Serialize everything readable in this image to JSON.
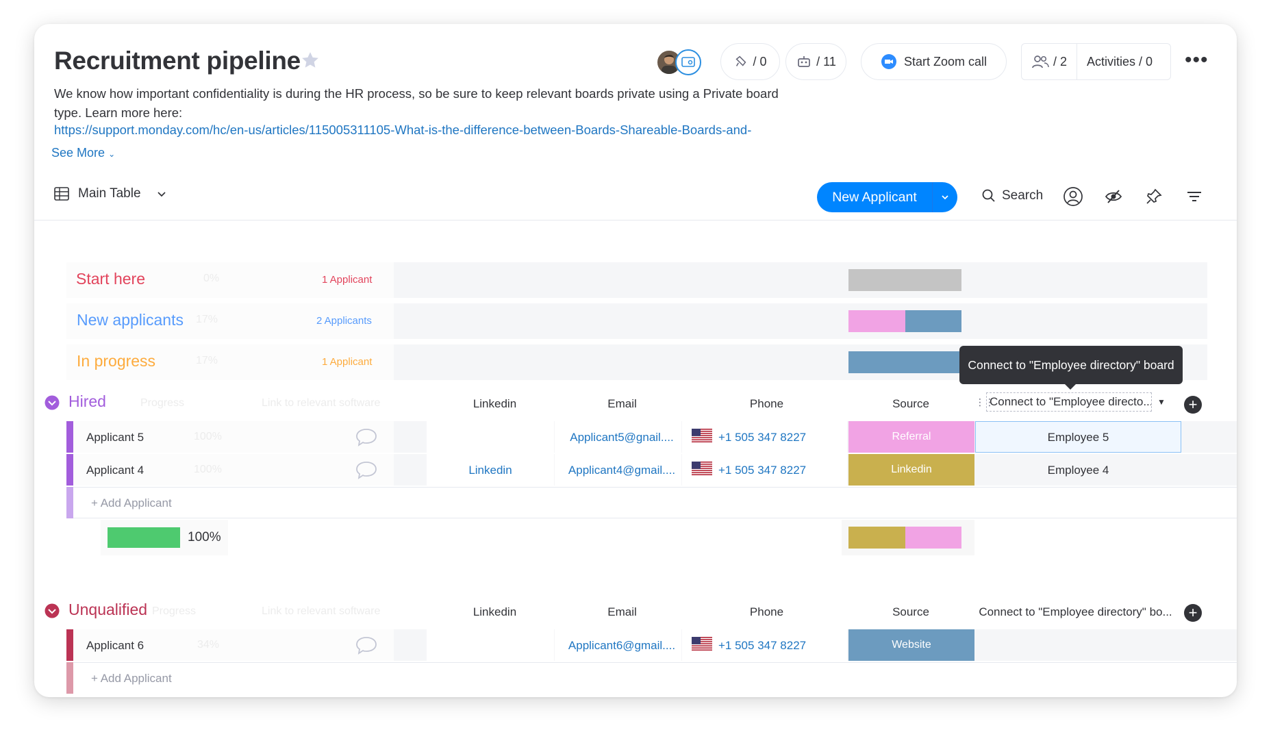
{
  "board": {
    "title": "Recruitment pipeline",
    "description": "We know how important confidentiality is during the HR process, so be sure to keep relevant boards private using a Private board type. Learn more here:",
    "link": "https://support.monday.com/hc/en-us/articles/115005311105-What-is-the-difference-between-Boards-Shareable-Boards-and-",
    "see_more": "See More"
  },
  "header": {
    "updates": "/ 0",
    "automations": "/ 11",
    "zoom": "Start Zoom call",
    "members": "/ 2",
    "activities": "Activities / 0"
  },
  "toolbar": {
    "view": "Main Table",
    "new_button": "New Applicant",
    "search": "Search"
  },
  "summary_groups": [
    {
      "name": "Start here",
      "percent": "0%",
      "count": "1 Applicant",
      "color": "#e2445c"
    },
    {
      "name": "New applicants",
      "percent": "17%",
      "count": "2 Applicants",
      "color": "#579bfc"
    },
    {
      "name": "In progress",
      "percent": "17%",
      "count": "1 Applicant",
      "color": "#fdab3d"
    }
  ],
  "columns": {
    "progress": "Progress",
    "software": "Link to relevant software",
    "linkedin": "Linkedin",
    "email": "Email",
    "phone": "Phone",
    "source": "Source",
    "connect": "Connect to \"Employee directo...",
    "connect_full": "Connect to \"Employee directory\" bo..."
  },
  "tooltip": "Connect to \"Employee directory\" board",
  "hired": {
    "name": "Hired",
    "color": "#a25ddc",
    "rows": [
      {
        "name": "Applicant 5",
        "progress": "100%",
        "linkedin": "",
        "email": "Applicant5@gnail....",
        "phone": "+1 505 347 8227",
        "source": "Referral",
        "source_color": "#f1a3e4",
        "connect": "Employee 5"
      },
      {
        "name": "Applicant 4",
        "progress": "100%",
        "linkedin": "Linkedin",
        "email": "Applicant4@gmail....",
        "phone": "+1 505 347 8227",
        "source": "Linkedin",
        "source_color": "#c9b04e",
        "connect": "Employee 4"
      }
    ],
    "add_item": "+ Add Applicant",
    "summary_percent": "100%",
    "summary_progress": 1.0,
    "source_summary": [
      {
        "share": 0.5,
        "color": "#c9b04e"
      },
      {
        "share": 0.5,
        "color": "#f1a3e4"
      }
    ]
  },
  "unqualified": {
    "name": "Unqualified",
    "color": "#bb3354",
    "rows": [
      {
        "name": "Applicant 6",
        "progress": "34%",
        "linkedin": "",
        "email": "Applicant6@gmail....",
        "phone": "+1 505 347 8227",
        "source": "Website",
        "source_color": "#6c9bbf",
        "connect": ""
      }
    ],
    "add_item": "+ Add Applicant"
  }
}
